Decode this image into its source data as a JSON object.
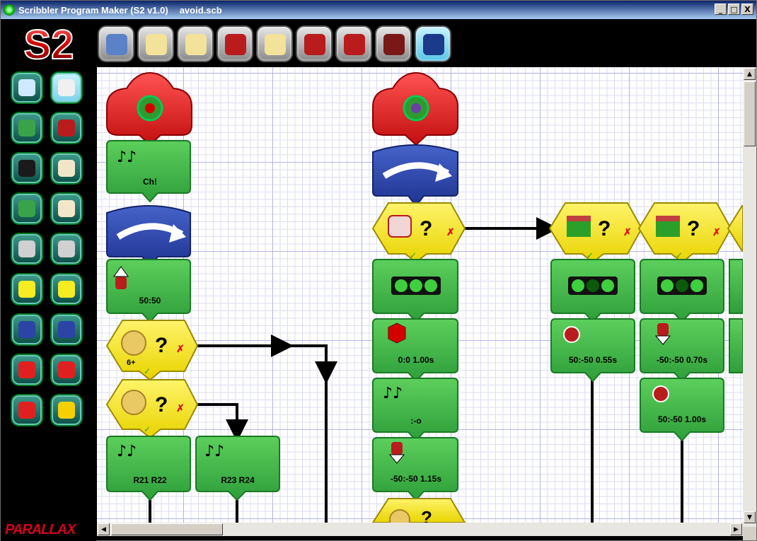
{
  "window": {
    "app_title": "Scribbler Program Maker (S2 v1.0)",
    "file_name": "avoid.scb",
    "minimize_label": "_",
    "maximize_label": "□",
    "close_label": "X"
  },
  "toolbar": {
    "logo_text": "S2",
    "buttons": [
      {
        "name": "new-program",
        "icon": "grid-document-icon",
        "color": "#5b82c9"
      },
      {
        "name": "open-file",
        "icon": "folder-open-icon",
        "color": "#f3e29a"
      },
      {
        "name": "save-file",
        "icon": "folder-save-icon",
        "color": "#f3e29a"
      },
      {
        "name": "load-robot",
        "icon": "robot-load-icon",
        "color": "#b91c1c"
      },
      {
        "name": "save-as",
        "icon": "list-save-icon",
        "color": "#f3e29a"
      },
      {
        "name": "robot-status",
        "icon": "robot-halo-icon",
        "color": "#b91c1c"
      },
      {
        "name": "robot-calibrate",
        "icon": "robot-compass-icon",
        "color": "#b91c1c"
      },
      {
        "name": "robot-info",
        "icon": "robot-info-icon",
        "color": "#7a1717"
      },
      {
        "name": "help",
        "icon": "question-icon",
        "color": "#1a3a8a"
      }
    ]
  },
  "palette": {
    "brand": "PARALLAX",
    "tools": [
      {
        "name": "zoom-tool",
        "icon": "magnifier-icon"
      },
      {
        "name": "pointer-tool",
        "icon": "hand-pointer-icon",
        "selected": true
      },
      {
        "name": "clipboard-tool",
        "icon": "clipboard-icon"
      },
      {
        "name": "move-tool",
        "icon": "move-robot-icon"
      },
      {
        "name": "leds-tool",
        "icon": "leds-icon"
      },
      {
        "name": "sound-tool",
        "icon": "music-notes-icon"
      },
      {
        "name": "flag-tool",
        "icon": "flag-icon"
      },
      {
        "name": "timer-tool",
        "icon": "hourglass-icon"
      },
      {
        "name": "subroutine-tool",
        "icon": "subroutine-icon"
      },
      {
        "name": "pen-tool",
        "icon": "pen-icon"
      },
      {
        "name": "condition-tool",
        "icon": "question-icon"
      },
      {
        "name": "and-condition-tool",
        "icon": "ampersand-question-icon"
      },
      {
        "name": "loop-tool",
        "icon": "loop-icon"
      },
      {
        "name": "loop-return-tool",
        "icon": "loop-return-icon"
      },
      {
        "name": "subroutine-call-tool",
        "icon": "red-cloud-icon"
      },
      {
        "name": "return-tool",
        "icon": "return-icon"
      },
      {
        "name": "exit-tool",
        "icon": "exit-icon"
      },
      {
        "name": "stop-tool",
        "icon": "stop-stripes-icon"
      }
    ]
  },
  "program": {
    "colors": {
      "start": "#e02020",
      "goto": "#2b44a6",
      "action": "#3ab54a",
      "condition": "#f5ec22",
      "wire": "#000000"
    },
    "labels": {
      "sound_chirp": "Ch!",
      "move_forward": "50:50",
      "coin_count": "6+",
      "sound_r21": "R21 R22",
      "sound_r23": "R23 R24",
      "stop_time": "0:0 1.00s",
      "sound_face": ":-o",
      "backup": "-50:-50 1.15s",
      "spin_right": "50:-50 0.55s",
      "back_left": "-50:-50 0.70s",
      "spin_right_2": "50:-50 1.00s"
    }
  }
}
